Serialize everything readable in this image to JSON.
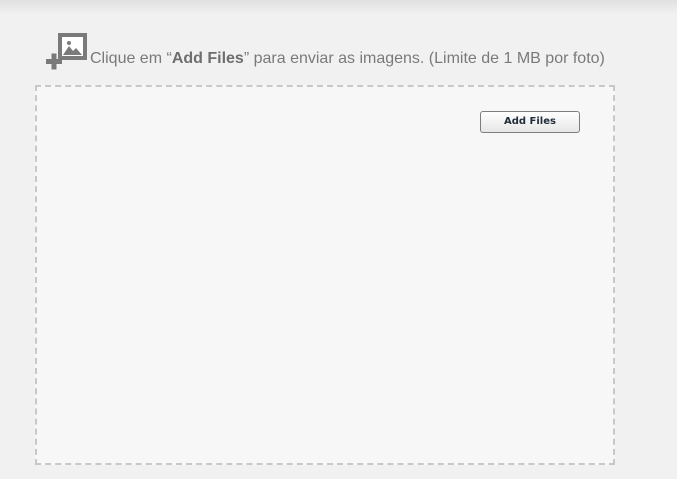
{
  "uploader": {
    "instruction_prefix": "Clique em “",
    "instruction_strong": "Add Files",
    "instruction_suffix": "” para enviar as imagens. (Limite de 1 MB por foto)",
    "icon": "add-image-icon",
    "add_files_label": "Add Files"
  },
  "colors": {
    "background": "#f1f1f1",
    "dropzone_background": "#f7f7f7",
    "dropzone_border": "#c8c8c8",
    "text": "#7a7a7a",
    "icon": "#7a7a7a"
  }
}
